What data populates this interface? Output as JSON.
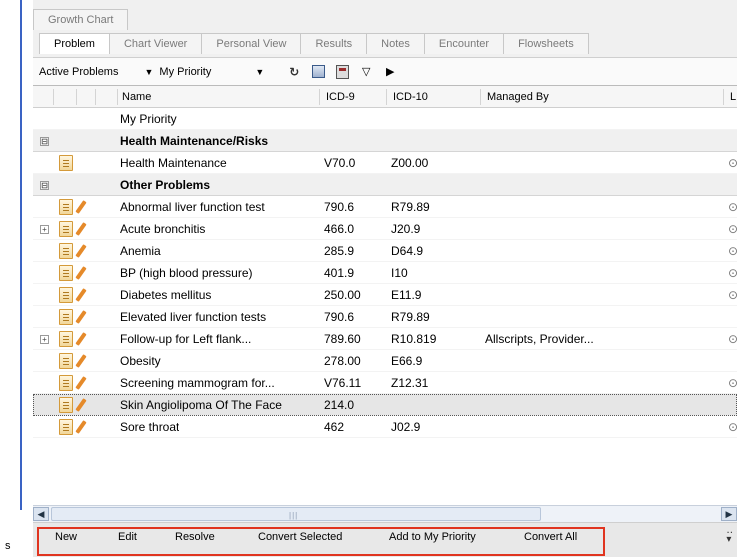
{
  "tabs_top": [
    "Growth Chart"
  ],
  "tabs": [
    {
      "label": "Problem",
      "active": true
    },
    {
      "label": "Chart Viewer",
      "active": false
    },
    {
      "label": "Personal View",
      "active": false
    },
    {
      "label": "Results",
      "active": false
    },
    {
      "label": "Notes",
      "active": false
    },
    {
      "label": "Encounter",
      "active": false
    },
    {
      "label": "Flowsheets",
      "active": false
    }
  ],
  "toolbar": {
    "list_label": "Active Problems",
    "view_select": "My Priority",
    "icons": [
      "refresh-icon",
      "print-icon",
      "calculator-icon",
      "filter-icon",
      "play-icon"
    ]
  },
  "columns": {
    "name": "Name",
    "icd9": "ICD-9",
    "icd10": "ICD-10",
    "managed_by": "Managed By",
    "last": "L"
  },
  "rows": [
    {
      "type": "label",
      "name": "My Priority"
    },
    {
      "type": "group",
      "name": "Health Maintenance/Risks",
      "expander": "⊟"
    },
    {
      "type": "item",
      "name": "Health Maintenance",
      "icd9": "V70.0",
      "icd10": "Z00.00",
      "managed_by": "",
      "last": "⊙",
      "pencil": false,
      "expander": ""
    },
    {
      "type": "group",
      "name": "Other Problems",
      "expander": "⊟"
    },
    {
      "type": "item",
      "name": "Abnormal liver function test",
      "icd9": "790.6",
      "icd10": "R79.89",
      "managed_by": "",
      "last": "⊙",
      "pencil": true,
      "expander": ""
    },
    {
      "type": "item",
      "name": "Acute bronchitis",
      "icd9": "466.0",
      "icd10": "J20.9",
      "managed_by": "",
      "last": "⊙",
      "pencil": true,
      "expander": "+"
    },
    {
      "type": "item",
      "name": "Anemia",
      "icd9": "285.9",
      "icd10": "D64.9",
      "managed_by": "",
      "last": "⊙",
      "pencil": true,
      "expander": ""
    },
    {
      "type": "item",
      "name": "BP (high blood pressure)",
      "icd9": "401.9",
      "icd10": "I10",
      "managed_by": "",
      "last": "⊙",
      "pencil": true,
      "expander": ""
    },
    {
      "type": "item",
      "name": "Diabetes mellitus",
      "icd9": "250.00",
      "icd10": "E11.9",
      "managed_by": "",
      "last": "⊙",
      "pencil": true,
      "expander": ""
    },
    {
      "type": "item",
      "name": "Elevated liver function tests",
      "icd9": "790.6",
      "icd10": "R79.89",
      "managed_by": "",
      "last": "",
      "pencil": true,
      "expander": ""
    },
    {
      "type": "item",
      "name": "Follow-up for Left flank...",
      "icd9": "789.60",
      "icd10": "R10.819",
      "managed_by": "Allscripts, Provider...",
      "last": "⊙",
      "pencil": true,
      "expander": "+"
    },
    {
      "type": "item",
      "name": "Obesity",
      "icd9": "278.00",
      "icd10": "E66.9",
      "managed_by": "",
      "last": "",
      "pencil": true,
      "expander": ""
    },
    {
      "type": "item",
      "name": "Screening mammogram for...",
      "icd9": "V76.11",
      "icd10": "Z12.31",
      "managed_by": "",
      "last": "⊙",
      "pencil": true,
      "expander": ""
    },
    {
      "type": "item",
      "name": "Skin Angiolipoma Of The Face",
      "icd9": "214.0",
      "icd10": "",
      "managed_by": "",
      "last": "",
      "pencil": true,
      "expander": "",
      "selected": true
    },
    {
      "type": "item",
      "name": "Sore throat",
      "icd9": "462",
      "icd10": "J02.9",
      "managed_by": "",
      "last": "⊙",
      "pencil": true,
      "expander": ""
    }
  ],
  "actions": [
    "New",
    "Edit",
    "Resolve",
    "Convert Selected",
    "Add to My Priority",
    "Convert All"
  ],
  "stray_text": "s",
  "colors": {
    "highlight_border": "#e0341f",
    "selection": "#e6e6e6",
    "left_rail": "#3a63c4"
  }
}
